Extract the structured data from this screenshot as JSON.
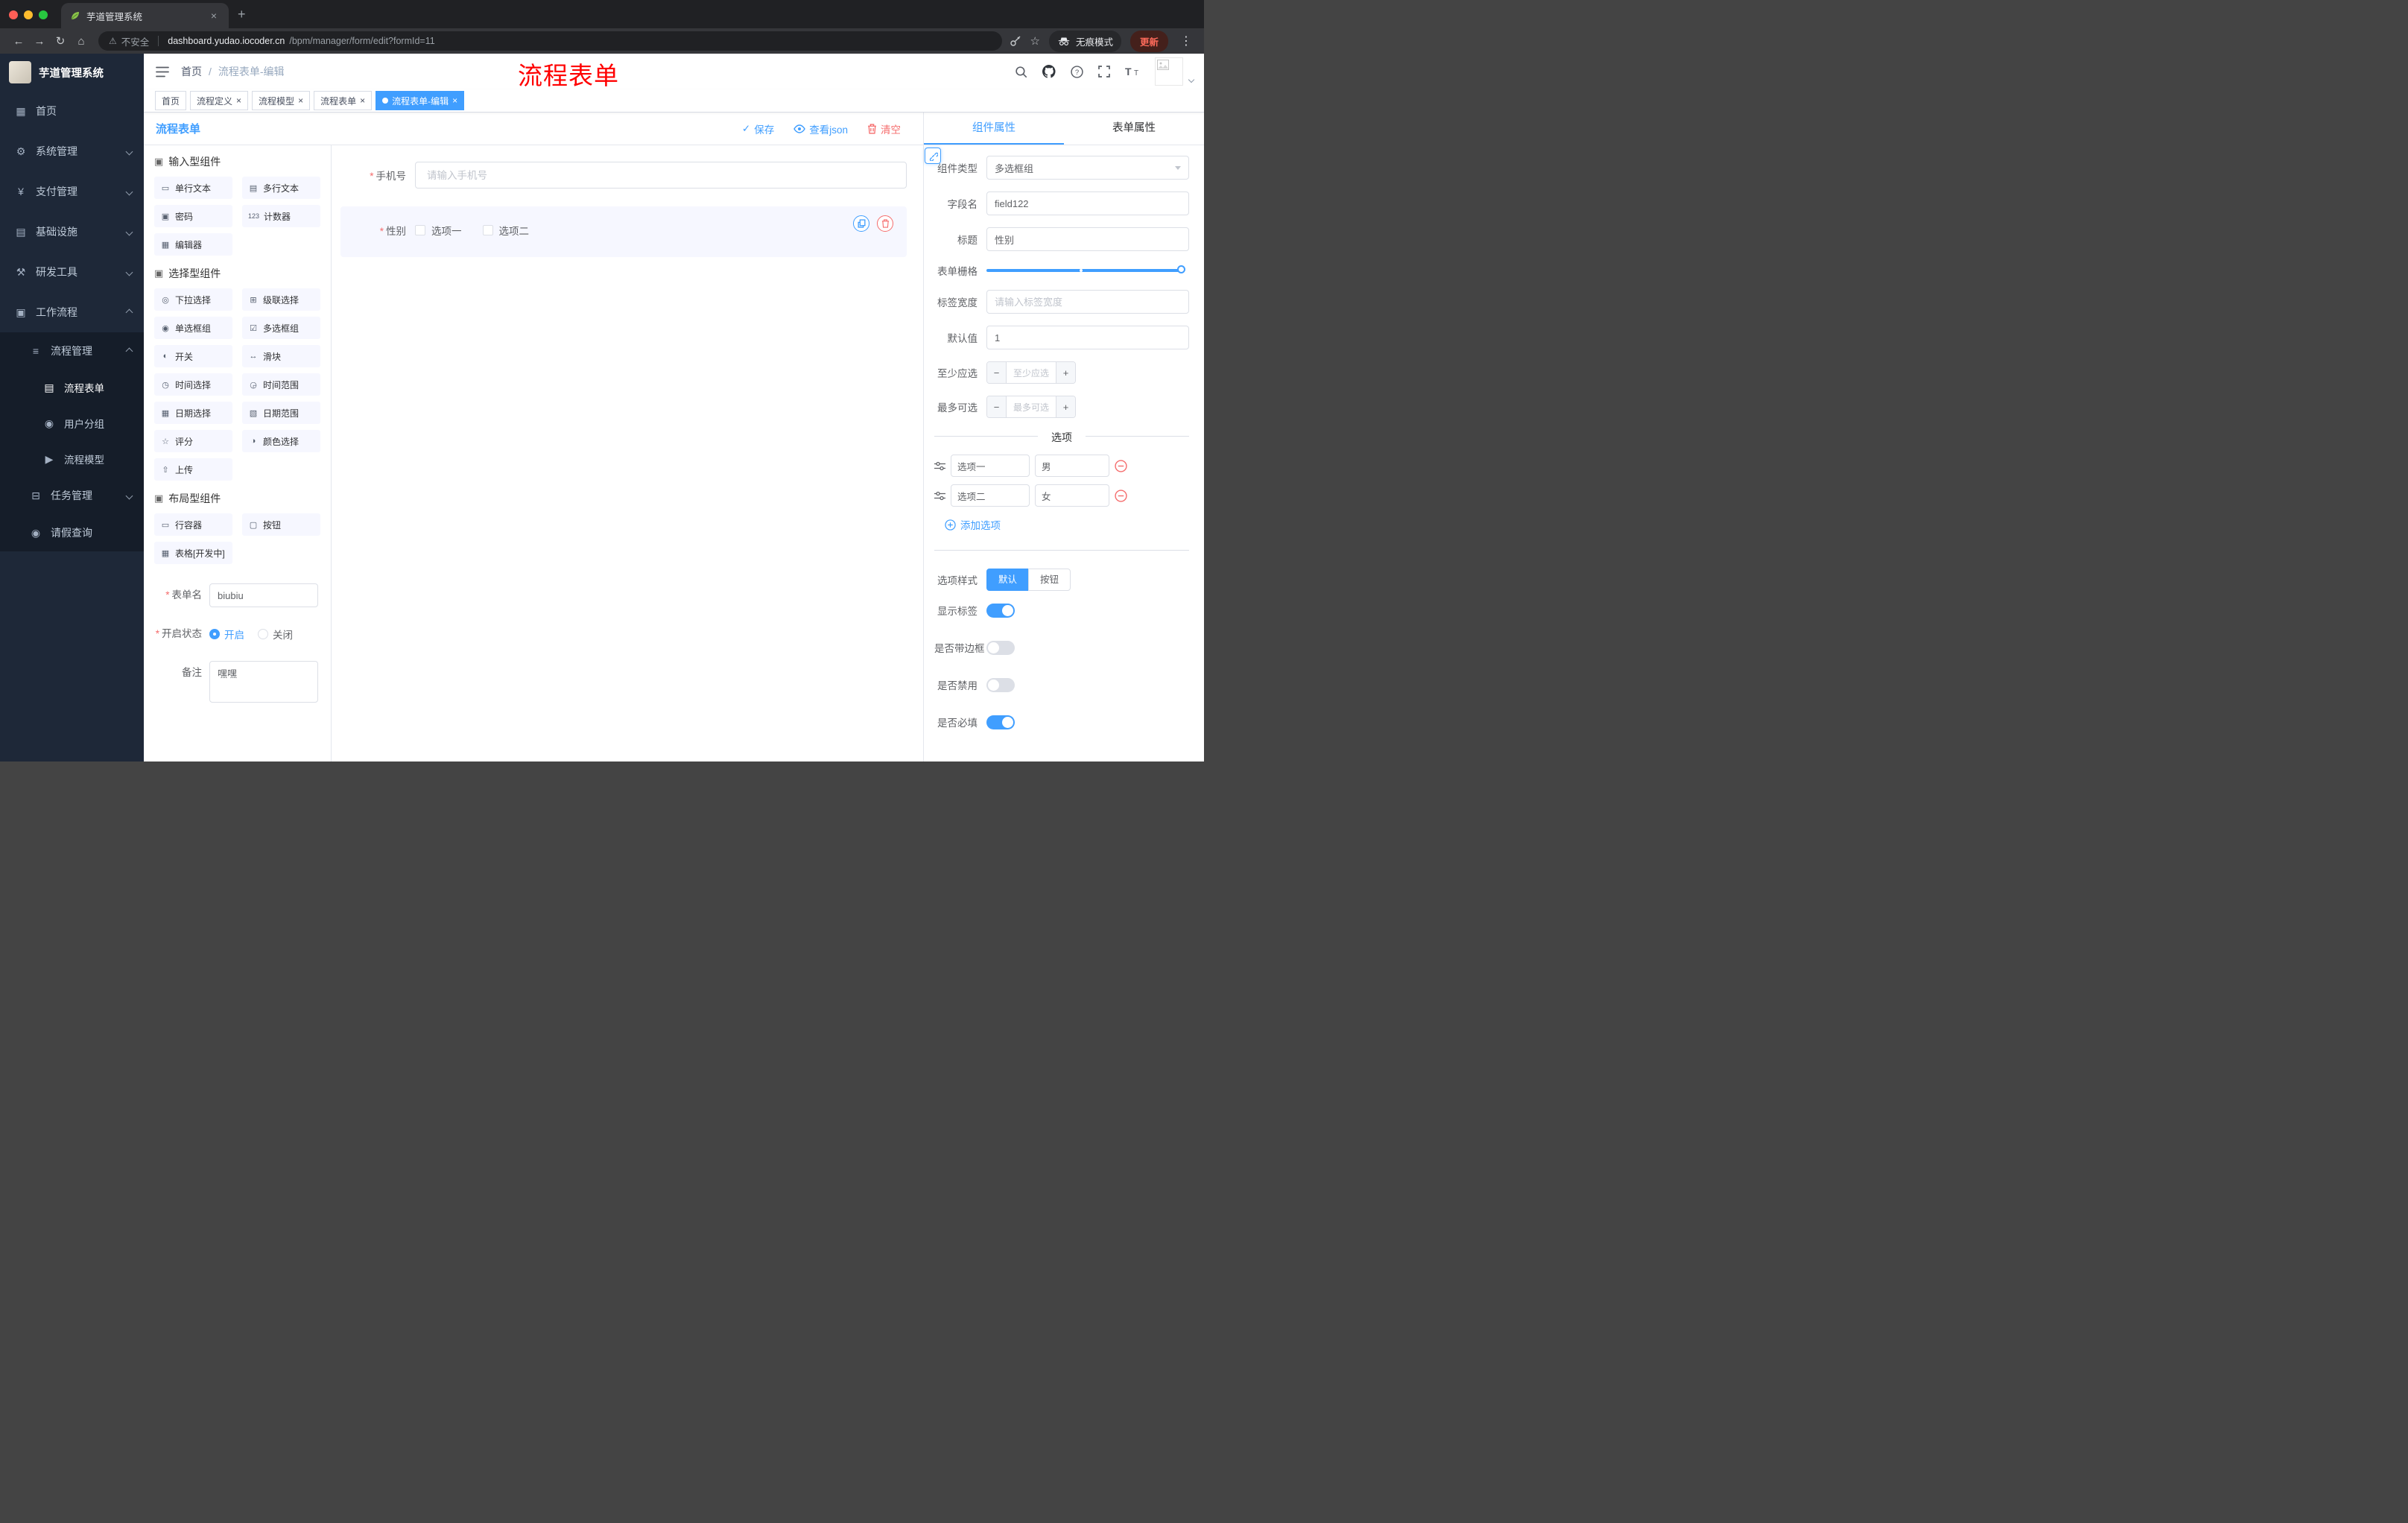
{
  "browser": {
    "tab_title": "芋道管理系统",
    "security_label": "不安全",
    "url_host": "dashboard.yudao.iocoder.cn",
    "url_path": "/bpm/manager/form/edit?formId=11",
    "incognito_label": "无痕模式",
    "update_label": "更新"
  },
  "icons": {
    "back": "←",
    "forward": "→",
    "reload": "↻",
    "home": "⌂",
    "warning": "⚠",
    "star": "☆",
    "overflow": "⋮",
    "new_tab": "+",
    "close": "×",
    "check": "✓",
    "minus": "−",
    "plus": "+",
    "breadcrumb_sep": "/"
  },
  "sidebar": {
    "brand": "芋道管理系统",
    "items": [
      {
        "label": "首页",
        "glyph": "▦"
      },
      {
        "label": "系统管理",
        "glyph": "⚙"
      },
      {
        "label": "支付管理",
        "glyph": "¥"
      },
      {
        "label": "基础设施",
        "glyph": "▤"
      },
      {
        "label": "研发工具",
        "glyph": "⚒"
      },
      {
        "label": "工作流程",
        "glyph": "▣"
      }
    ],
    "workflow_submenu": [
      {
        "label": "流程管理",
        "glyph": "≡"
      },
      {
        "label": "流程表单",
        "glyph": "▤"
      },
      {
        "label": "用户分组",
        "glyph": "◉"
      },
      {
        "label": "流程模型",
        "glyph": "▶"
      },
      {
        "label": "任务管理",
        "glyph": "⊟"
      },
      {
        "label": "请假查询",
        "glyph": "◉"
      }
    ]
  },
  "header": {
    "breadcrumb_home": "首页",
    "breadcrumb_current": "流程表单-编辑",
    "annotation": "流程表单"
  },
  "tags": {
    "items": [
      {
        "label": "首页"
      },
      {
        "label": "流程定义"
      },
      {
        "label": "流程模型"
      },
      {
        "label": "流程表单"
      },
      {
        "label": "流程表单-编辑"
      }
    ]
  },
  "palette": {
    "title": "流程表单",
    "sections": [
      {
        "title": "输入型组件",
        "items": [
          {
            "label": "单行文本",
            "glyph": "▭"
          },
          {
            "label": "多行文本",
            "glyph": "▤"
          },
          {
            "label": "密码",
            "glyph": "▣"
          },
          {
            "label": "计数器",
            "glyph": "123"
          },
          {
            "label": "编辑器",
            "glyph": "▦"
          }
        ]
      },
      {
        "title": "选择型组件",
        "items": [
          {
            "label": "下拉选择",
            "glyph": "◎"
          },
          {
            "label": "级联选择",
            "glyph": "⊞"
          },
          {
            "label": "单选框组",
            "glyph": "◉"
          },
          {
            "label": "多选框组",
            "glyph": "☑"
          },
          {
            "label": "开关",
            "glyph": "◐"
          },
          {
            "label": "滑块",
            "glyph": "↔"
          },
          {
            "label": "时间选择",
            "glyph": "◷"
          },
          {
            "label": "时间范围",
            "glyph": "◶"
          },
          {
            "label": "日期选择",
            "glyph": "▦"
          },
          {
            "label": "日期范围",
            "glyph": "▧"
          },
          {
            "label": "评分",
            "glyph": "☆"
          },
          {
            "label": "颜色选择",
            "glyph": "◑"
          },
          {
            "label": "上传",
            "glyph": "⇧"
          }
        ]
      },
      {
        "title": "布局型组件",
        "items": [
          {
            "label": "行容器",
            "glyph": "▭"
          },
          {
            "label": "按钮",
            "glyph": "▢"
          },
          {
            "label": "表格[开发中]",
            "glyph": "▦"
          }
        ]
      }
    ],
    "form": {
      "name_label": "表单名",
      "name_value": "biubiu",
      "status_label": "开启状态",
      "status_on": "开启",
      "status_off": "关闭",
      "remark_label": "备注",
      "remark_value": "嘿嘿"
    }
  },
  "canvas": {
    "actions": {
      "save": "保存",
      "view_json": "查看json",
      "clear": "清空"
    },
    "phone_field": {
      "label": "手机号",
      "placeholder": "请输入手机号"
    },
    "gender_field": {
      "label": "性别",
      "option1": "选项一",
      "option2": "选项二"
    }
  },
  "props": {
    "tabs": {
      "component": "组件属性",
      "form": "表单属性"
    },
    "fields": {
      "type_label": "组件类型",
      "type_value": "多选框组",
      "field_label": "字段名",
      "field_value": "field122",
      "title_label": "标题",
      "title_value": "性别",
      "grid_label": "表单栅格",
      "label_width_label": "标签宽度",
      "label_width_placeholder": "请输入标签宽度",
      "default_label": "默认值",
      "default_value": "1",
      "min_label": "至少应选",
      "min_placeholder": "至少应选",
      "max_label": "最多可选",
      "max_placeholder": "最多可选"
    },
    "options_divider": "选项",
    "options": [
      {
        "label": "选项一",
        "value": "男"
      },
      {
        "label": "选项二",
        "value": "女"
      }
    ],
    "add_option": "添加选项",
    "style_label": "选项样式",
    "style_default": "默认",
    "style_button": "按钮",
    "switches": [
      {
        "label": "显示标签"
      },
      {
        "label": "是否带边框"
      },
      {
        "label": "是否禁用"
      },
      {
        "label": "是否必填"
      }
    ]
  },
  "colors": {
    "accent": "#409eff",
    "danger": "#f56c6c",
    "annotation": "#ff0000"
  }
}
